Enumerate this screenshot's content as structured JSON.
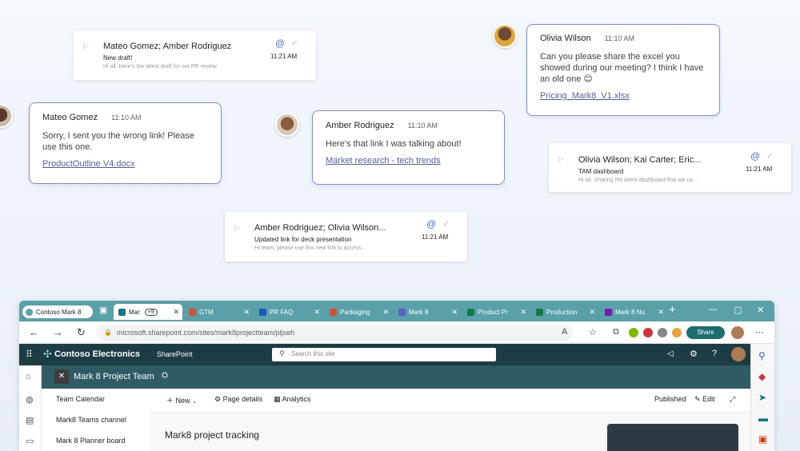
{
  "notifications": [
    {
      "title": "Mateo Gomez; Amber Rodriguez",
      "subject": "New draft!",
      "preview": "Hi all, Here's the latest draft for our PR review.",
      "time": "11:21 AM"
    },
    {
      "title": "Olivia Wilson; Kai Carter; Eric...",
      "subject": "TAM dashboard",
      "preview": "Hi all, Sharing the latest dashboard that we ca...",
      "time": "11:21 AM"
    },
    {
      "title": "Amber Rodriguez; Olivia Wilson...",
      "subject": "Updated link for deck presentation",
      "preview": "Hi team, please use this new link to access...",
      "time": "11:21 AM"
    }
  ],
  "chats": [
    {
      "author": "Olivia Wilson",
      "time": "11:10 AM",
      "body": "Can you please share the excel you showed during our meeting? I think I have an old one 😊",
      "link": "Pricing_Mark8_V1.xlsx"
    },
    {
      "author": "Mateo Gomez",
      "time": "11:10 AM",
      "body": "Sorry, I sent you the wrong link! Please use this one.",
      "link": "ProductOutline V4.docx"
    },
    {
      "author": "Amber Rodriguez",
      "time": "11:10 AM",
      "body": "Here's that link I was talking about!",
      "link": "Market research - tech trends"
    }
  ],
  "browser": {
    "profile": "Contoso Mark 8",
    "tabs": [
      {
        "label": "Mar",
        "color": "#0f7b8a"
      },
      {
        "label": "GTM",
        "color": "#d35230"
      },
      {
        "label": "PR FAQ",
        "color": "#185abd"
      },
      {
        "label": "Packaging",
        "color": "#d35230"
      },
      {
        "label": "Mark 8",
        "color": "#5b5fc7"
      },
      {
        "label": "Product Pr",
        "color": "#107c41"
      },
      {
        "label": "Production",
        "color": "#107c41"
      },
      {
        "label": "Mark 8 Nu",
        "color": "#7719aa"
      }
    ],
    "tab_count": "+9",
    "url": "microsoft.sharepoint.com/sites/mark8projectteam/pljseh",
    "share_label": "Share"
  },
  "sharepoint": {
    "brand": "Contoso Electronics",
    "app": "SharePoint",
    "search_placeholder": "Search this site",
    "site_title": "Mark 8 Project Team",
    "nav": [
      "Team Calendar",
      "Mark8 Teams channel",
      "Mark 8 Planner board"
    ],
    "cmd_new": "New",
    "cmd_page_details": "Page details",
    "cmd_analytics": "Analytics",
    "status": "Published",
    "edit": "Edit",
    "page_heading": "Mark8 project tracking"
  }
}
